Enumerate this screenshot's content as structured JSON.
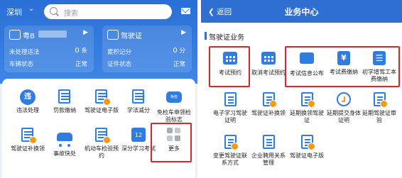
{
  "left": {
    "city": "深圳",
    "search_placeholder": "搜索",
    "vehicle_card": {
      "title": "粤B",
      "row1_label": "未处理违法",
      "row1_value": "0",
      "row1_unit": "条",
      "row2_label": "车辆状态",
      "row2_value": "正常"
    },
    "license_card": {
      "title": "驾驶证",
      "row1_label": "累积记分",
      "row1_value": "0",
      "row1_unit": "分",
      "row2_label": "证件状态",
      "row2_value": "正常"
    },
    "grid": [
      {
        "label": "违法处理",
        "icon": "violation-icon",
        "glyph": "违"
      },
      {
        "label": "罚款缴纳",
        "icon": "fine-payment-icon"
      },
      {
        "label": "驾驶证电子版",
        "icon": "e-license-icon"
      },
      {
        "label": "学法减分",
        "icon": "study-deduct-icon"
      },
      {
        "label": "免检车申领检验标志",
        "icon": "exempt-inspection-icon",
        "glyph": "免检"
      },
      {
        "label": "驾驶证补换领",
        "icon": "license-renew-icon"
      },
      {
        "label": "事故快处",
        "icon": "accident-icon"
      },
      {
        "label": "机动车检验预约",
        "icon": "vehicle-inspection-icon"
      },
      {
        "label": "深分学习考试",
        "icon": "study-exam-icon",
        "glyph": "12"
      },
      {
        "label": "更多",
        "icon": "more-icon"
      }
    ]
  },
  "right": {
    "back_label": "返回",
    "title": "业务中心",
    "section_title": "驾驶证业务",
    "grid": [
      {
        "label": "考试预约",
        "icon": "exam-booking-icon"
      },
      {
        "label": "取消考试预约",
        "icon": "cancel-booking-icon"
      },
      {
        "label": "考试信息公布",
        "icon": "exam-info-icon"
      },
      {
        "label": "考试费缴纳",
        "icon": "exam-fee-icon",
        "glyph": "¥"
      },
      {
        "label": "初学增驾工本费缴纳",
        "icon": "fee-list-icon",
        "glyph": "☰"
      },
      {
        "label": "电子学习驾驶证明",
        "icon": "e-learning-cert-icon"
      },
      {
        "label": "驾驶证补换领",
        "icon": "license-replace-icon"
      },
      {
        "label": "延期换领驾驶证",
        "icon": "extend-renew-icon"
      },
      {
        "label": "延期提交身体证明",
        "icon": "extend-medical-icon"
      },
      {
        "label": "延期驾驶证审验",
        "icon": "extend-review-icon"
      },
      {
        "label": "变更驾驶证联系方式",
        "icon": "change-contact-icon"
      },
      {
        "label": "企业聘用关系管理",
        "icon": "employer-icon"
      },
      {
        "label": "驾驶证电子版",
        "icon": "e-license-icon"
      }
    ]
  },
  "colors": {
    "primary": "#2f7de1",
    "highlight": "#e02424",
    "badge": "#f39a1e"
  }
}
